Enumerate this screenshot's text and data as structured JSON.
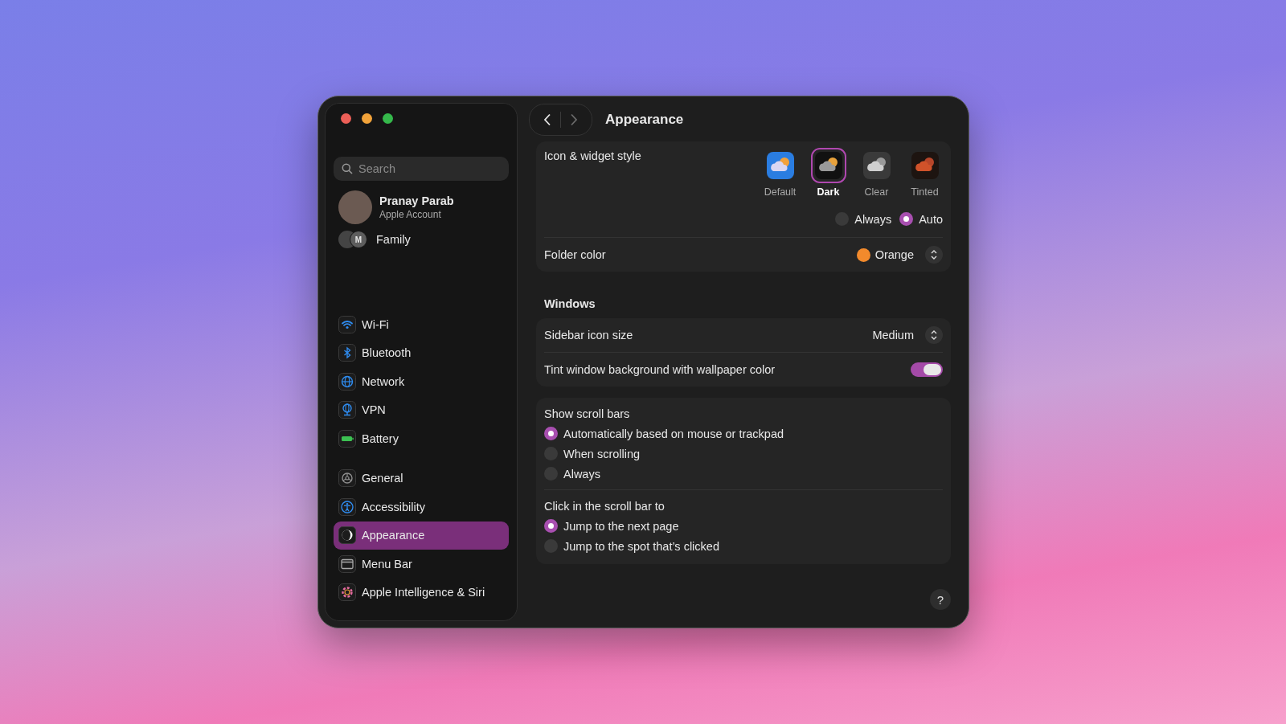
{
  "sidebar": {
    "search": {
      "placeholder": "Search"
    },
    "account": {
      "name": "Pranay Parab",
      "subtitle": "Apple Account"
    },
    "family": {
      "label": "Family",
      "initial": "M"
    },
    "groups": [
      [
        {
          "label": "Wi-Fi",
          "selected": false
        },
        {
          "label": "Bluetooth",
          "selected": false
        },
        {
          "label": "Network",
          "selected": false
        },
        {
          "label": "VPN",
          "selected": false
        },
        {
          "label": "Battery",
          "selected": false
        }
      ],
      [
        {
          "label": "General",
          "selected": false
        },
        {
          "label": "Accessibility",
          "selected": false
        },
        {
          "label": "Appearance",
          "selected": true
        },
        {
          "label": "Menu Bar",
          "selected": false
        },
        {
          "label": "Apple Intelligence & Siri",
          "selected": false
        }
      ]
    ]
  },
  "toolbar": {
    "title": "Appearance",
    "forward_disabled": true
  },
  "icon_style": {
    "label": "Icon & widget style",
    "options": [
      {
        "label": "Default",
        "selected": false
      },
      {
        "label": "Dark",
        "selected": true
      },
      {
        "label": "Clear",
        "selected": false
      },
      {
        "label": "Tinted",
        "selected": false
      }
    ],
    "modes": [
      {
        "label": "Always",
        "selected": false
      },
      {
        "label": "Auto",
        "selected": true
      }
    ]
  },
  "folder_color": {
    "label": "Folder color",
    "value": "Orange"
  },
  "windows": {
    "heading": "Windows",
    "sidebar_icon_size": {
      "label": "Sidebar icon size",
      "value": "Medium"
    },
    "tint": {
      "label": "Tint window background with wallpaper color",
      "on": true
    }
  },
  "scroll_bars": {
    "label": "Show scroll bars",
    "options": [
      {
        "label": "Automatically based on mouse or trackpad",
        "selected": true
      },
      {
        "label": "When scrolling",
        "selected": false
      },
      {
        "label": "Always",
        "selected": false
      }
    ]
  },
  "click_scroll_bar": {
    "label": "Click in the scroll bar to",
    "options": [
      {
        "label": "Jump to the next page",
        "selected": true
      },
      {
        "label": "Jump to the spot that’s clicked",
        "selected": false
      }
    ]
  },
  "help": {
    "label": "?"
  }
}
